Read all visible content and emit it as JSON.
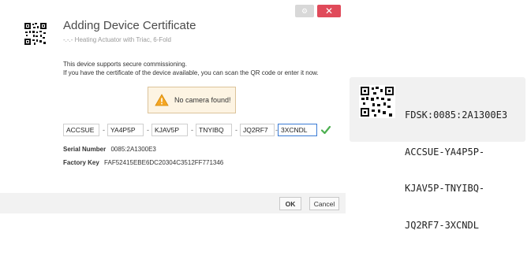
{
  "dialog": {
    "title": "Adding Device Certificate",
    "subtitle": "-.-.- Heating Actuator with Triac, 6-Fold",
    "settings_label": "⚙",
    "close_label": "✕",
    "description_line1": "This device supports secure commissioning.",
    "description_line2": "If you have the certificate of the device available, you can scan the QR code or enter it now.",
    "camera_warning": "No camera found!",
    "key_fields": [
      "ACCSUE",
      "YA4P5P",
      "KJAV5P",
      "TNYIBQ",
      "JQ2RF7",
      "3XCNDL"
    ],
    "separator": "-",
    "serial_label": "Serial Number",
    "serial_value": "0085:2A1300E3",
    "factory_key_label": "Factory Key",
    "factory_key_value": "FAF52415EBE6DC20304C3512FF771346",
    "ok_label": "OK",
    "cancel_label": "Cancel"
  },
  "device_label": {
    "line1": "FDSK:0085:2A1300E3",
    "line2": "ACCSUE-YA4P5P-",
    "line3": "KJAV5P-TNYIBQ-",
    "line4": "JQ2RF7-3XCNDL"
  },
  "colors": {
    "close_button": "#e04a5a",
    "warning_bg": "#fdf4e3",
    "check": "#4caf50",
    "active_field_border": "#3a7bd5"
  }
}
